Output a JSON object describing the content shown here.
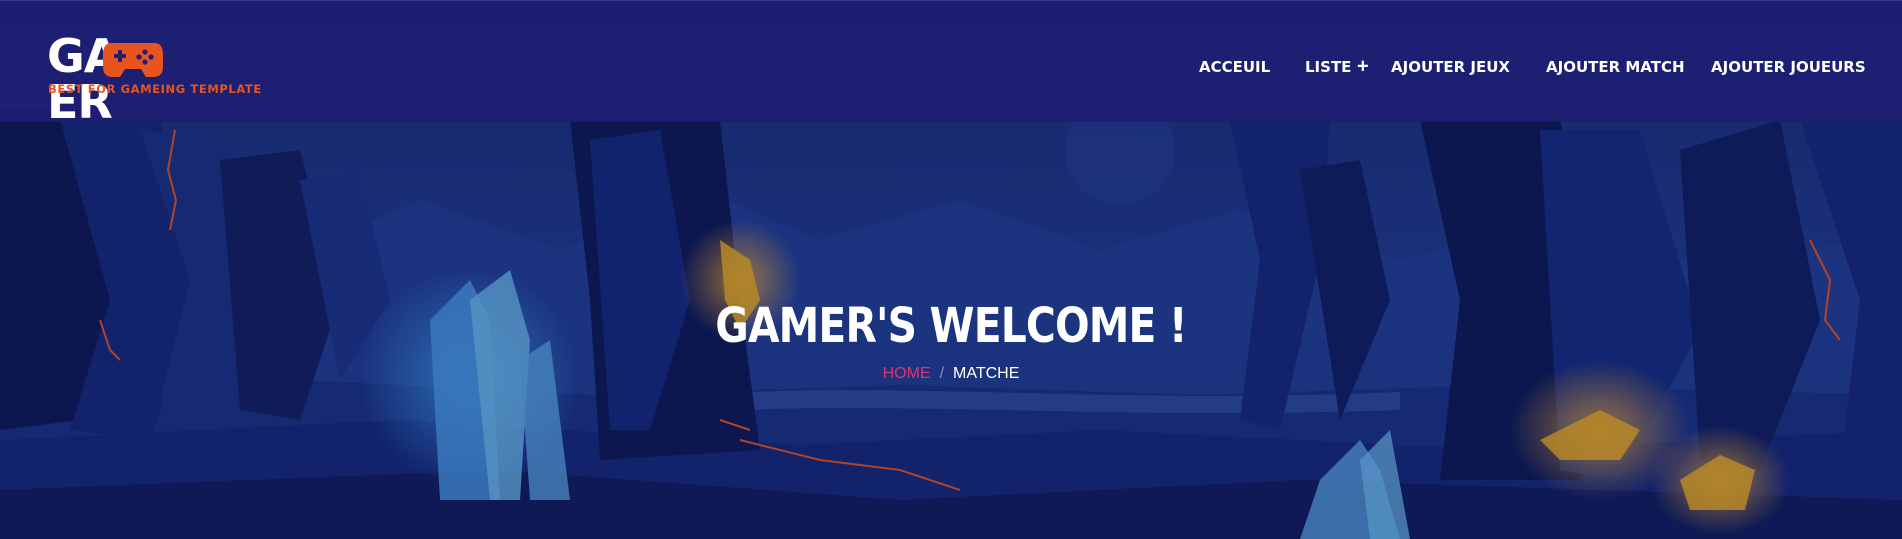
{
  "logo": {
    "text_left": "GA",
    "text_right": "ER",
    "tagline": "BEST FOR GAMEING TEMPLATE",
    "icon": "gamepad-icon"
  },
  "nav": {
    "items": [
      {
        "label": "ACCEUIL"
      },
      {
        "label": "LISTE"
      },
      {
        "label": "AJOUTER JEUX"
      },
      {
        "label": "AJOUTER MATCH"
      },
      {
        "label": "AJOUTER JOUEURS"
      }
    ],
    "expand_icon": "plus-icon"
  },
  "hero": {
    "title": "GAMER'S WELCOME !",
    "breadcrumb": {
      "home": "HOME",
      "separator": "/",
      "current": "MATCHE"
    }
  },
  "colors": {
    "header_bg": "#1e1e73",
    "accent_orange": "#e8541f",
    "breadcrumb_home": "#e0336d",
    "text": "#ffffff"
  }
}
